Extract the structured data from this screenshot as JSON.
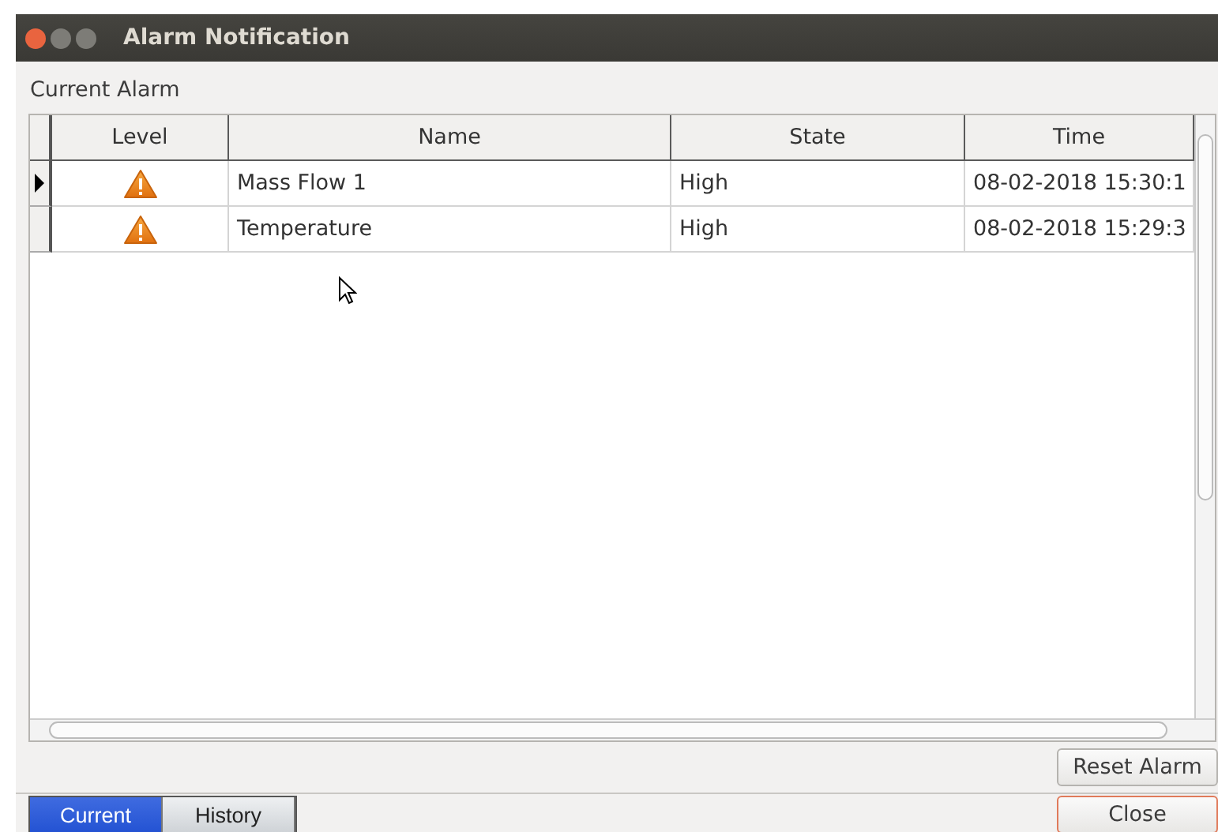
{
  "window": {
    "title": "Alarm Notification"
  },
  "section_label": "Current Alarm",
  "table": {
    "columns": [
      "Level",
      "Name",
      "State",
      "Time"
    ],
    "rows": [
      {
        "selected": true,
        "kind": "warning",
        "name": "Mass Flow 1",
        "state": "High",
        "time": "08-02-2018 15:30:1"
      },
      {
        "selected": false,
        "kind": "warning",
        "name": "Temperature",
        "state": "High",
        "time": "08-02-2018 15:29:3"
      }
    ]
  },
  "reset_button": "Reset Alarm",
  "tabs": [
    {
      "label": "Current",
      "selected": true
    },
    {
      "label": "History",
      "selected": false
    }
  ],
  "close_button": "Close"
}
